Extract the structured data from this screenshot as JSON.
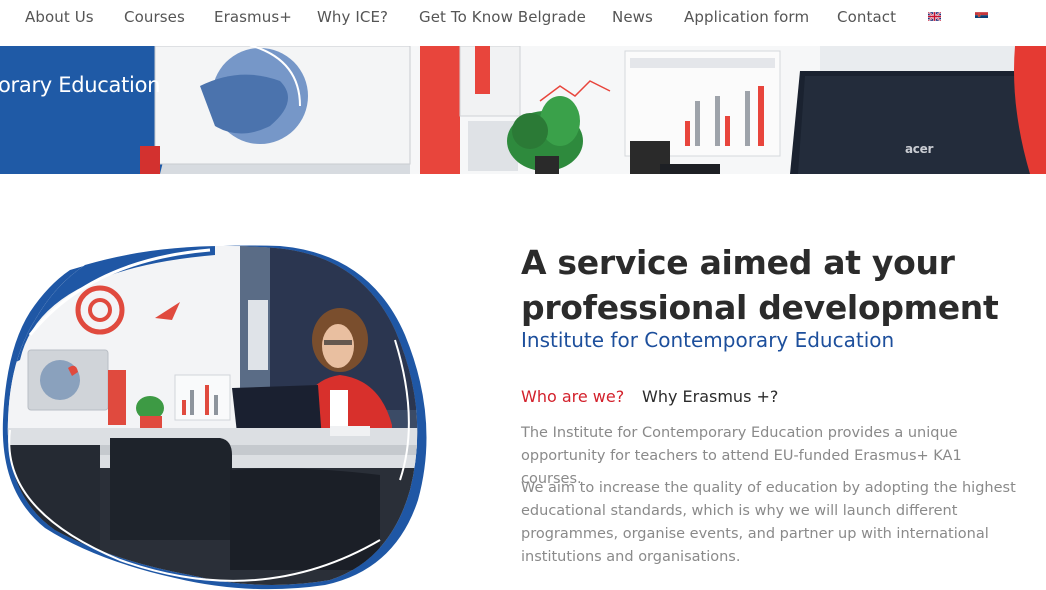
{
  "nav": {
    "items": [
      "About Us",
      "Courses",
      "Erasmus+",
      "Why ICE?",
      "Get To Know Belgrade",
      "News",
      "Application form",
      "Contact"
    ],
    "flags": [
      "uk-flag-icon",
      "serbia-flag-icon"
    ]
  },
  "hero": {
    "text": "orary Education",
    "laptop_brand": "acer"
  },
  "main": {
    "headline_line1": "A service aimed at your",
    "headline_line2": "professional development",
    "subheading": "Institute for Contemporary Education",
    "tabs": [
      {
        "label": "Who are we?",
        "active": true
      },
      {
        "label": "Why Erasmus +?",
        "active": false
      }
    ],
    "paragraph1": "The Institute for Contemporary Education provides a unique opportunity for teachers to attend EU-funded Erasmus+  KA1 courses.",
    "paragraph2": "We aim to increase the quality of education by adopting the highest educational standards, which is why we will launch different programmes, organise events, and partner up with international institutions and organisations."
  },
  "colors": {
    "brand_blue": "#1d4f9c",
    "accent_red": "#d3212c",
    "text_dark": "#2b2b2b",
    "text_gray": "#8a8a8a"
  }
}
